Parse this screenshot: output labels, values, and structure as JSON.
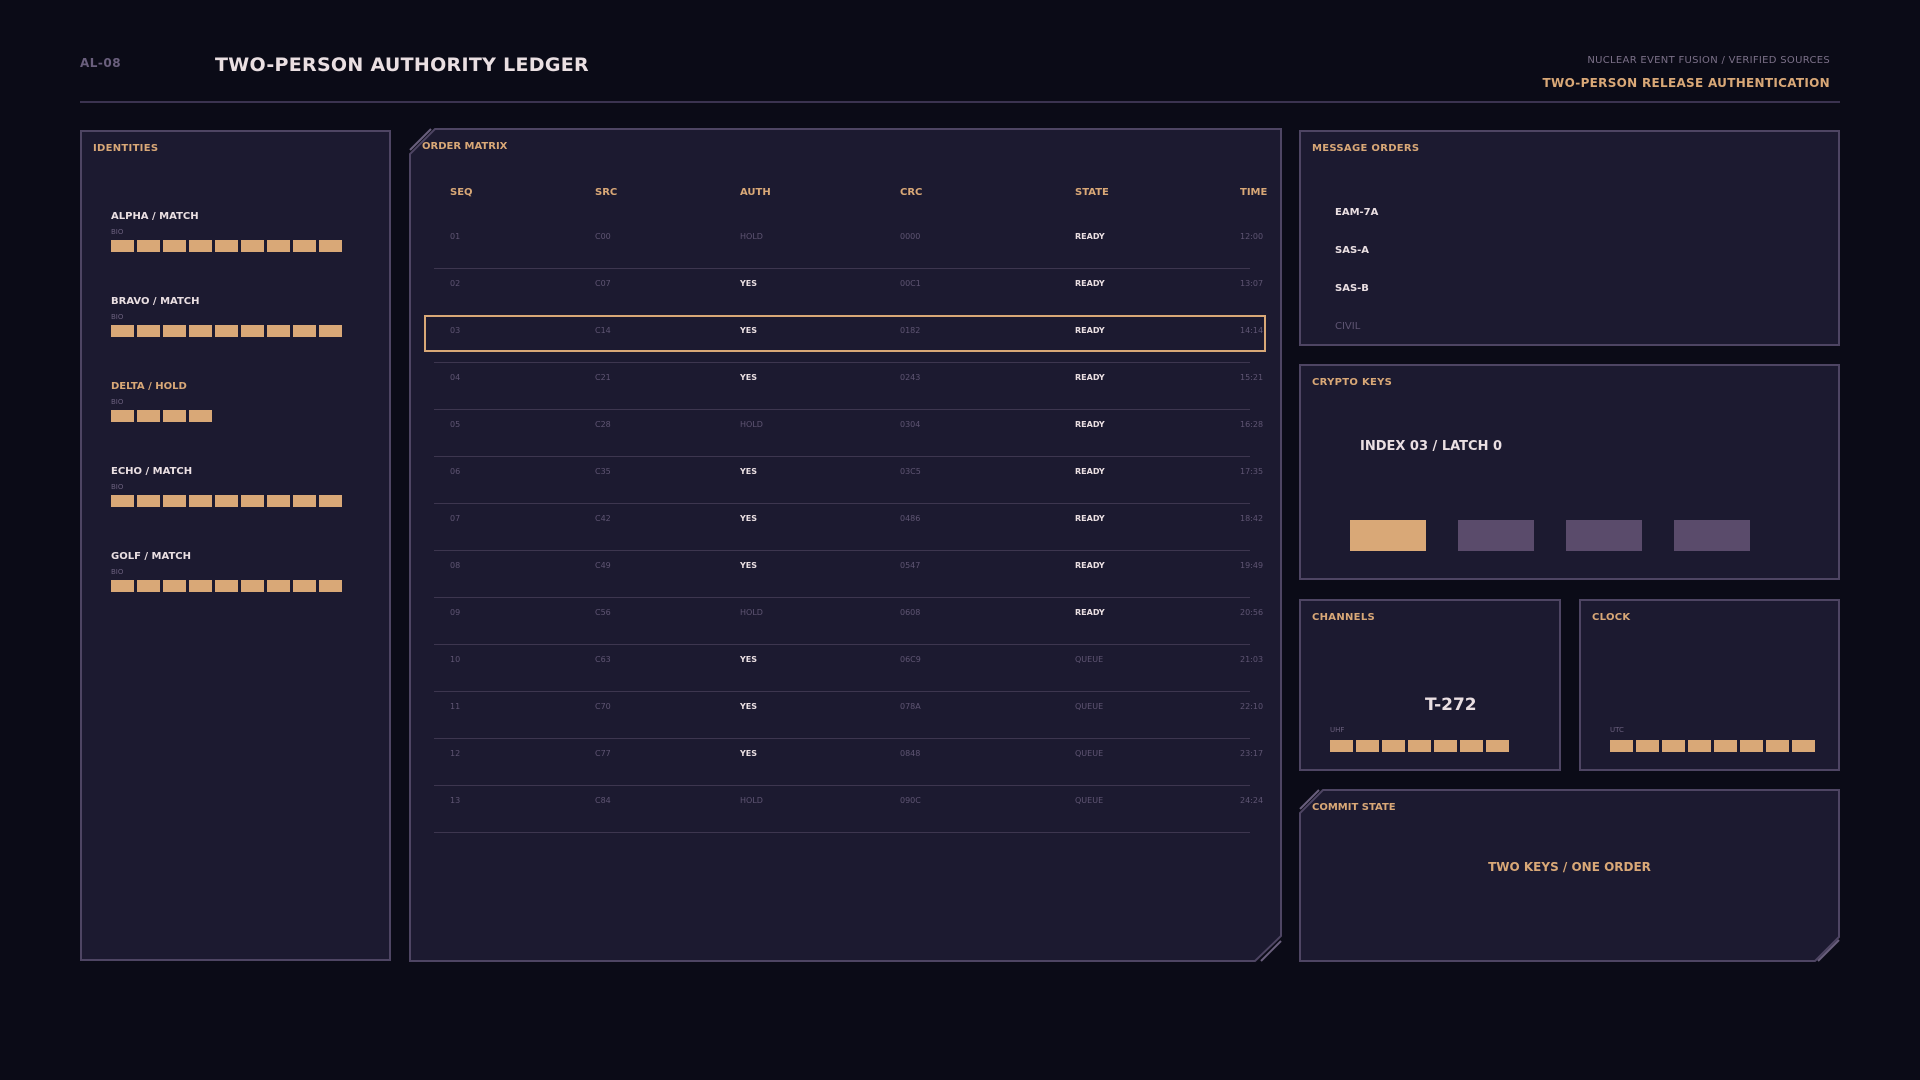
{
  "header": {
    "code": "AL-08",
    "title": "TWO-PERSON AUTHORITY LEDGER",
    "source": "NUCLEAR EVENT FUSION / VERIFIED SOURCES",
    "mode": "TWO-PERSON RELEASE AUTHENTICATION"
  },
  "identities": {
    "title": "IDENTITIES",
    "bio_label": "BIO",
    "items": [
      {
        "name": "ALPHA / MATCH",
        "status": "match",
        "level": 9
      },
      {
        "name": "BRAVO / MATCH",
        "status": "match",
        "level": 9
      },
      {
        "name": "DELTA / HOLD",
        "status": "hold",
        "level": 4
      },
      {
        "name": "ECHO / MATCH",
        "status": "match",
        "level": 9
      },
      {
        "name": "GOLF / MATCH",
        "status": "match",
        "level": 9
      }
    ]
  },
  "matrix": {
    "title": "ORDER MATRIX",
    "columns": [
      "SEQ",
      "SRC",
      "AUTH",
      "CRC",
      "STATE",
      "TIME"
    ],
    "selected_row": 2,
    "rows": [
      [
        "01",
        "C00",
        "HOLD",
        "0000",
        "READY",
        "12:00"
      ],
      [
        "02",
        "C07",
        "YES",
        "00C1",
        "READY",
        "13:07"
      ],
      [
        "03",
        "C14",
        "YES",
        "0182",
        "READY",
        "14:14"
      ],
      [
        "04",
        "C21",
        "YES",
        "0243",
        "READY",
        "15:21"
      ],
      [
        "05",
        "C28",
        "HOLD",
        "0304",
        "READY",
        "16:28"
      ],
      [
        "06",
        "C35",
        "YES",
        "03C5",
        "READY",
        "17:35"
      ],
      [
        "07",
        "C42",
        "YES",
        "0486",
        "READY",
        "18:42"
      ],
      [
        "08",
        "C49",
        "YES",
        "0547",
        "READY",
        "19:49"
      ],
      [
        "09",
        "C56",
        "HOLD",
        "0608",
        "READY",
        "20:56"
      ],
      [
        "10",
        "C63",
        "YES",
        "06C9",
        "QUEUE",
        "21:03"
      ],
      [
        "11",
        "C70",
        "YES",
        "078A",
        "QUEUE",
        "22:10"
      ],
      [
        "12",
        "C77",
        "YES",
        "0848",
        "QUEUE",
        "23:17"
      ],
      [
        "13",
        "C84",
        "HOLD",
        "090C",
        "QUEUE",
        "24:24"
      ]
    ]
  },
  "messages": {
    "title": "MESSAGE ORDERS",
    "items": [
      {
        "label": "EAM-7A",
        "active": true
      },
      {
        "label": "SAS-A",
        "active": true
      },
      {
        "label": "SAS-B",
        "active": true
      },
      {
        "label": "CIVIL",
        "active": false
      }
    ]
  },
  "crypto": {
    "title": "CRYPTO KEYS",
    "index_label": "INDEX 03 / LATCH 0",
    "keys": [
      {
        "state": "latched",
        "color": "#d9a877"
      },
      {
        "state": "open",
        "color": "#5a4b6b"
      },
      {
        "state": "open",
        "color": "#5a4b6b"
      },
      {
        "state": "open",
        "color": "#5a4b6b"
      }
    ]
  },
  "channels": {
    "title": "CHANNELS",
    "countdown": "T-272",
    "band_label": "UHF",
    "level": 7
  },
  "clock": {
    "title": "CLOCK",
    "zone_label": "UTC",
    "level": 8
  },
  "commit": {
    "title": "COMMIT STATE",
    "status": "TWO KEYS / ONE ORDER"
  },
  "colors": {
    "accent": "#d9a877",
    "panel": "#1c1a30",
    "border": "#4e4563",
    "background": "#0b0b17"
  }
}
